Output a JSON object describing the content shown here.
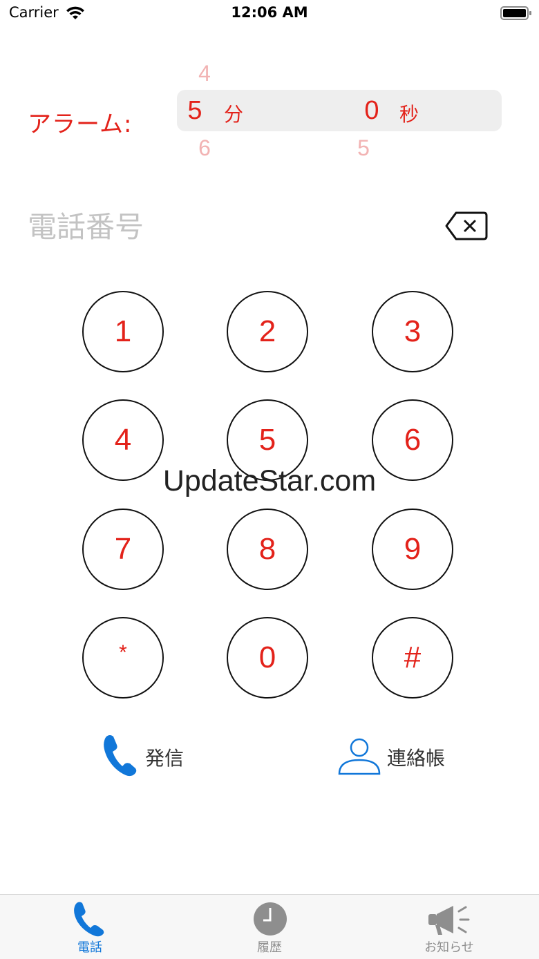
{
  "status_bar": {
    "carrier": "Carrier",
    "time": "12:06 AM"
  },
  "alarm": {
    "label": "アラーム:",
    "minutes": {
      "above": "4",
      "selected": "5",
      "below": "6",
      "unit": "分"
    },
    "seconds": {
      "selected": "0",
      "below": "5",
      "unit": "秒"
    }
  },
  "phone": {
    "placeholder": "電話番号",
    "value": ""
  },
  "keypad": {
    "keys": [
      "1",
      "2",
      "3",
      "4",
      "5",
      "6",
      "7",
      "8",
      "9",
      "*",
      "0",
      "#"
    ]
  },
  "watermark": "UpdateStar.com",
  "actions": {
    "call_label": "発信",
    "contacts_label": "連絡帳"
  },
  "tabs": [
    {
      "label": "電話",
      "icon": "phone-icon",
      "active": true
    },
    {
      "label": "履歴",
      "icon": "clock-icon",
      "active": false
    },
    {
      "label": "お知らせ",
      "icon": "megaphone-icon",
      "active": false
    }
  ],
  "colors": {
    "accent_red": "#e3221a",
    "tab_active_blue": "#1177d9",
    "tab_inactive_gray": "#8e8e8e"
  }
}
